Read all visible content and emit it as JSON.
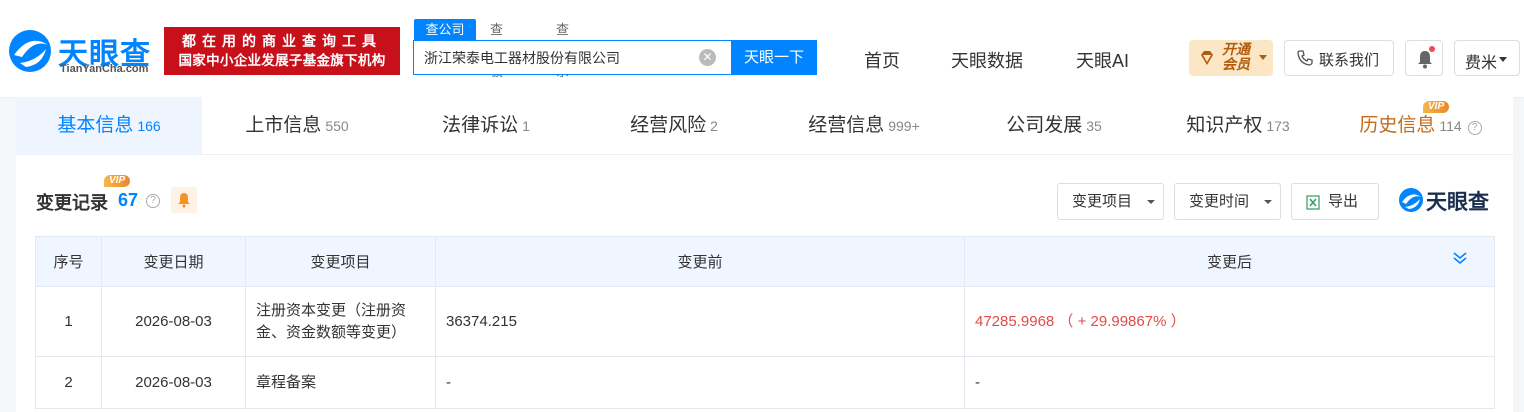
{
  "logo": {
    "name": "天眼查",
    "url": "TianYanCha.com"
  },
  "banner": {
    "line1": "都在用的商业查询工具",
    "line2": "国家中小企业发展子基金旗下机构"
  },
  "search": {
    "tabs": [
      "查公司",
      "查老板",
      "查关系"
    ],
    "value": "浙江荣泰电工器材股份有限公司",
    "button": "天眼一下"
  },
  "nav": [
    "首页",
    "天眼数据",
    "天眼AI"
  ],
  "header": {
    "vip_line1": "开通",
    "vip_line2": "会员",
    "contact": "联系我们",
    "user": "费米"
  },
  "tabs": [
    {
      "label": "基本信息",
      "count": "166"
    },
    {
      "label": "上市信息",
      "count": "550"
    },
    {
      "label": "法律诉讼",
      "count": "1"
    },
    {
      "label": "经营风险",
      "count": "2"
    },
    {
      "label": "经营信息",
      "count": "999+"
    },
    {
      "label": "公司发展",
      "count": "35"
    },
    {
      "label": "知识产权",
      "count": "173"
    },
    {
      "label": "历史信息",
      "count": "114",
      "tag": "VIP"
    }
  ],
  "section": {
    "title": "变更记录",
    "count": "67",
    "tag": "VIP",
    "filters": [
      "变更项目",
      "变更时间"
    ],
    "export": "导出",
    "watermark": "天眼查"
  },
  "table": {
    "headers": [
      "序号",
      "变更日期",
      "变更项目",
      "变更前",
      "变更后"
    ],
    "rows": [
      {
        "no": "1",
        "date": "2026-08-03",
        "item": "注册资本变更（注册资金、资金数额等变更）",
        "before": "36374.215",
        "after": "47285.9968 （ + 29.99867% ）"
      },
      {
        "no": "2",
        "date": "2026-08-03",
        "item": "章程备案",
        "before": "-",
        "after": "-"
      }
    ]
  },
  "colors": {
    "accent": "#0084ff",
    "banner": "#c8101a",
    "increase": "#e24a4a",
    "vip": "#e88a2a"
  }
}
